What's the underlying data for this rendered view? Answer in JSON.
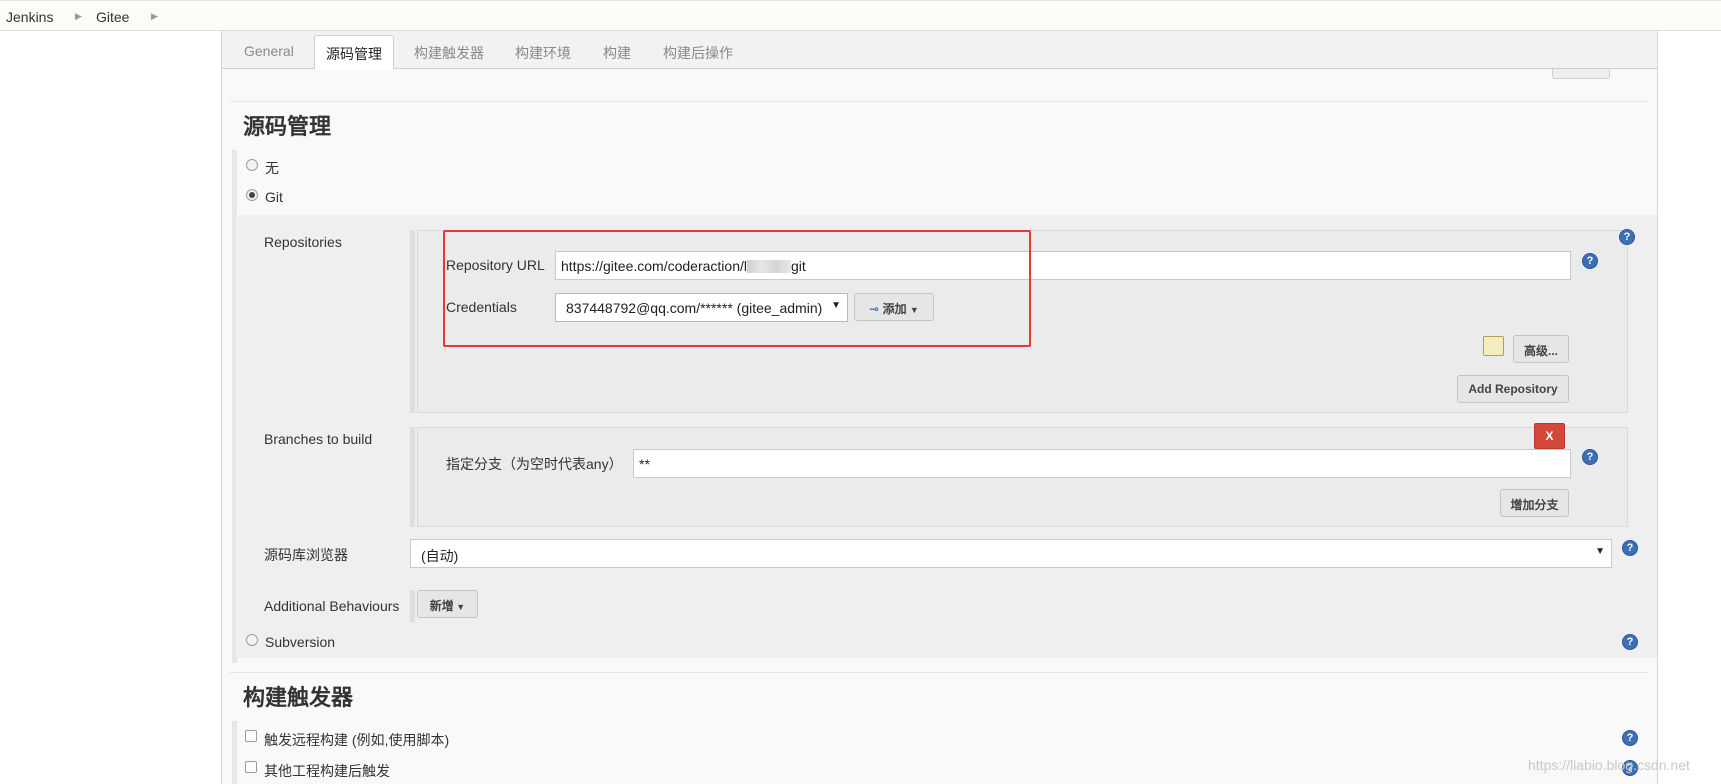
{
  "breadcrumb": {
    "items": [
      "Jenkins",
      "Gitee"
    ]
  },
  "tabs": [
    "General",
    "源码管理",
    "构建触发器",
    "构建环境",
    "构建",
    "构建后操作"
  ],
  "scm_section": {
    "title": "源码管理",
    "options": {
      "none": "无",
      "git": "Git",
      "subversion": "Subversion"
    },
    "selected": "Git"
  },
  "git": {
    "repositories_label": "Repositories",
    "repo_url_label": "Repository URL",
    "repo_url_value_prefix": "https://gitee.com/coderaction/l",
    "repo_url_value_suffix": "git",
    "credentials_label": "Credentials",
    "credentials_value": "837448792@qq.com/****** (gitee_admin)",
    "add_button": "添加",
    "advanced_button": "高级...",
    "add_repository_button": "Add Repository",
    "branches_label": "Branches to build",
    "branch_spec_label": "指定分支（为空时代表any）",
    "branch_spec_value": "**",
    "delete_branch_button": "X",
    "add_branch_button": "增加分支",
    "browser_label": "源码库浏览器",
    "browser_value": "(自动)",
    "behaviours_label": "Additional Behaviours",
    "behaviours_button": "新增"
  },
  "trigger_section": {
    "title": "构建触发器",
    "options": [
      "触发远程构建 (例如,使用脚本)",
      "其他工程构建后触发"
    ]
  },
  "watermark": "https://liabio.blog.csdn.net",
  "colors": {
    "accent_red": "#d24939",
    "help_blue": "#3d6fb4",
    "highlight_box": "#e53935"
  },
  "icons": {
    "help": "help-icon",
    "key": "key-icon",
    "notepad": "notepad-icon"
  }
}
